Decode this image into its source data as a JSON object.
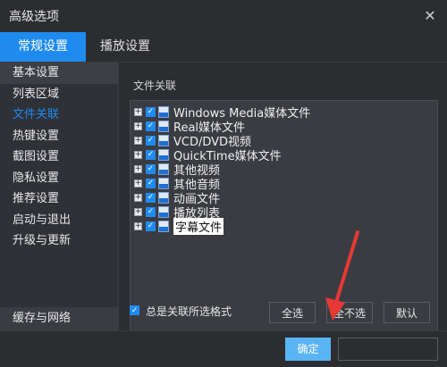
{
  "window": {
    "title": "高级选项"
  },
  "tabs": [
    {
      "label": "常规设置",
      "active": true
    },
    {
      "label": "播放设置",
      "active": false
    }
  ],
  "sidebar": {
    "items": [
      {
        "label": "基本设置"
      },
      {
        "label": "列表区域"
      },
      {
        "label": "文件关联",
        "active": true
      },
      {
        "label": "热键设置"
      },
      {
        "label": "截图设置"
      },
      {
        "label": "隐私设置"
      },
      {
        "label": "推荐设置"
      },
      {
        "label": "启动与退出"
      },
      {
        "label": "升级与更新"
      }
    ],
    "bottom_item": "缓存与网络"
  },
  "main": {
    "section_label": "文件关联",
    "file_types": [
      {
        "label": "Windows Media媒体文件",
        "icon_code": "ASF",
        "checked": true
      },
      {
        "label": "Real媒体文件",
        "icon_code": "REAL",
        "checked": true
      },
      {
        "label": "VCD/DVD视频",
        "icon_code": "SRT",
        "checked": true
      },
      {
        "label": "QuickTime媒体文件",
        "icon_code": "QT",
        "checked": true
      },
      {
        "label": "其他视频",
        "icon_code": "DAT",
        "checked": true
      },
      {
        "label": "其他音频",
        "icon_code": "MP3",
        "checked": true
      },
      {
        "label": "动画文件",
        "icon_code": "FLV",
        "checked": true
      },
      {
        "label": "播放列表",
        "icon_code": "LIST",
        "checked": true
      },
      {
        "label": "字幕文件",
        "icon_code": "SRT",
        "checked": true,
        "selected": true
      }
    ],
    "always_associate_label": "总是关联所选格式",
    "buttons": {
      "select_all": "全选",
      "select_none": "全不选",
      "default": "默认"
    }
  },
  "footer": {
    "ok_label": "确定",
    "cancel_label": ""
  },
  "colors": {
    "accent": "#1f8bf0",
    "ok_button": "#5ab4f3",
    "annotation_arrow": "#e53935"
  }
}
